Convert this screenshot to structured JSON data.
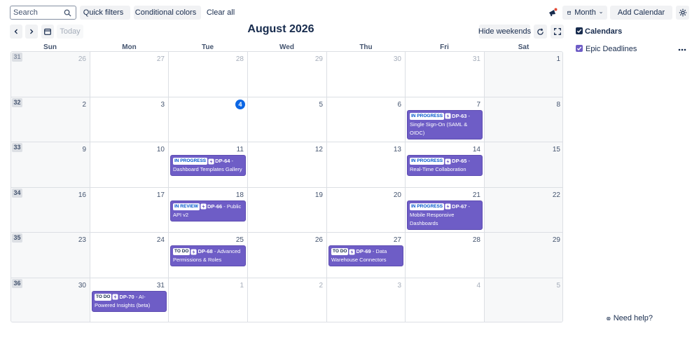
{
  "toolbar": {
    "search_placeholder": "Search",
    "quick_filters": "Quick filters",
    "conditional_colors": "Conditional colors",
    "clear_all": "Clear all",
    "view": "Month",
    "add_calendar": "Add Calendar"
  },
  "nav": {
    "today": "Today",
    "title": "August 2026",
    "hide_weekends": "Hide weekends"
  },
  "weekdays": [
    "Sun",
    "Mon",
    "Tue",
    "Wed",
    "Thu",
    "Fri",
    "Sat"
  ],
  "weeks": [
    {
      "number": "31",
      "days": [
        "26",
        "27",
        "28",
        "29",
        "30",
        "31",
        "1"
      ]
    },
    {
      "number": "32",
      "days": [
        "2",
        "3",
        "4",
        "5",
        "6",
        "7",
        "8"
      ]
    },
    {
      "number": "33",
      "days": [
        "9",
        "10",
        "11",
        "12",
        "13",
        "14",
        "15"
      ]
    },
    {
      "number": "34",
      "days": [
        "16",
        "17",
        "18",
        "19",
        "20",
        "21",
        "22"
      ]
    },
    {
      "number": "35",
      "days": [
        "23",
        "24",
        "25",
        "26",
        "27",
        "28",
        "29"
      ]
    },
    {
      "number": "36",
      "days": [
        "30",
        "31",
        "1",
        "2",
        "3",
        "4",
        "5"
      ]
    }
  ],
  "today": "4",
  "events": [
    {
      "status": "IN PROGRESS",
      "key": "DP-63",
      "summary": " - Single Sign-On (SAML & OIDC)"
    },
    {
      "status": "IN PROGRESS",
      "key": "DP-64",
      "summary": " - Dashboard Templates Gallery"
    },
    {
      "status": "IN PROGRESS",
      "key": "DP-65",
      "summary": " - Real-Time Collaboration"
    },
    {
      "status": "IN REVIEW",
      "key": "DP-66",
      "summary": " - Public API v2"
    },
    {
      "status": "IN PROGRESS",
      "key": "DP-67",
      "summary": " - Mobile Responsive Dashboards"
    },
    {
      "status": "TO DO",
      "key": "DP-68",
      "summary": " - Advanced Permissions & Roles"
    },
    {
      "status": "TO DO",
      "key": "DP-69",
      "summary": " - Data Warehouse Connectors"
    },
    {
      "status": "TO DO",
      "key": "DP-70",
      "summary": " - AI-Powered Insights (beta)"
    }
  ],
  "sidebar": {
    "calendars_label": "Calendars",
    "calendar_item": "Epic Deadlines"
  },
  "help": "Need help?",
  "colors": {
    "event_purple": "#6e5dc6",
    "today_blue": "#0c66e4",
    "checkbox_dark": "#172b4d",
    "checkbox_purple": "#6e5dc6",
    "notification_red": "#e34935"
  },
  "icons": [
    "search-icon",
    "chevron-down-icon",
    "megaphone-icon",
    "calendar-icon",
    "plus-icon",
    "gear-icon",
    "chevron-left-icon",
    "chevron-right-icon",
    "refresh-icon",
    "fullscreen-icon",
    "more-icon",
    "help-icon",
    "epic-icon"
  ]
}
